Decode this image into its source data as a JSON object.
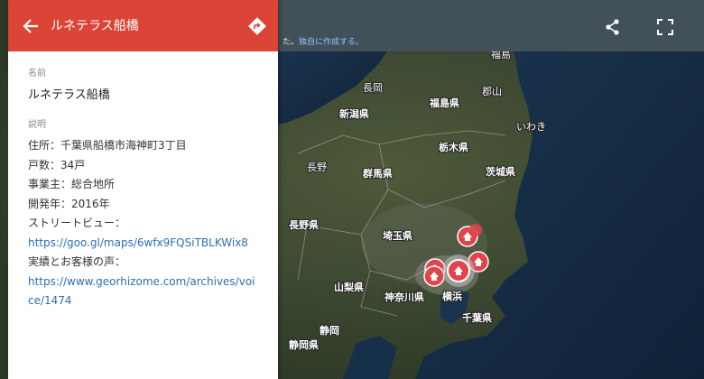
{
  "panel": {
    "title": "ルネテラス船橋",
    "name_heading": "名前",
    "name_value": "ルネテラス船橋",
    "desc_heading": "説明",
    "address": "住所：千葉県船橋市海神町3丁目",
    "units": "戸数：34戸",
    "developer": "事業主：総合地所",
    "year": "開発年：2016年",
    "streetview_label": "ストリートビュー：",
    "streetview_url": "https://goo.gl/maps/6wfx9FQSiTBLKWix8",
    "voice_label": "実績とお客様の声：",
    "voice_url_line1": "https://www.georhizome.com/archives/voi",
    "voice_url_line2": "ce/1474"
  },
  "topbar": {
    "hint_prefix": "た。",
    "hint_link": "独自に作成する。"
  },
  "map": {
    "labels": {
      "fukushima_city": "福島",
      "nagaoka": "長岡",
      "koriyama": "郡山",
      "niigata_pref": "新潟県",
      "fukushima_pref": "福島県",
      "iwaki": "いわき",
      "tochigi_pref": "栃木県",
      "nagano_city": "長野",
      "gunma_pref": "群馬県",
      "ibaraki_pref": "茨城県",
      "nagano_pref": "長野県",
      "saitama_pref": "埼玉県",
      "yamanashi_pref": "山梨県",
      "kanagawa_pref": "神奈川県",
      "yokohama": "横浜",
      "chiba_pref": "千葉県",
      "shizuoka_city": "静岡",
      "shizuoka_pref": "静岡県"
    },
    "colors": {
      "marker": "#e0454a",
      "panel_header": "#db4437",
      "topbar": "#42505a"
    }
  }
}
